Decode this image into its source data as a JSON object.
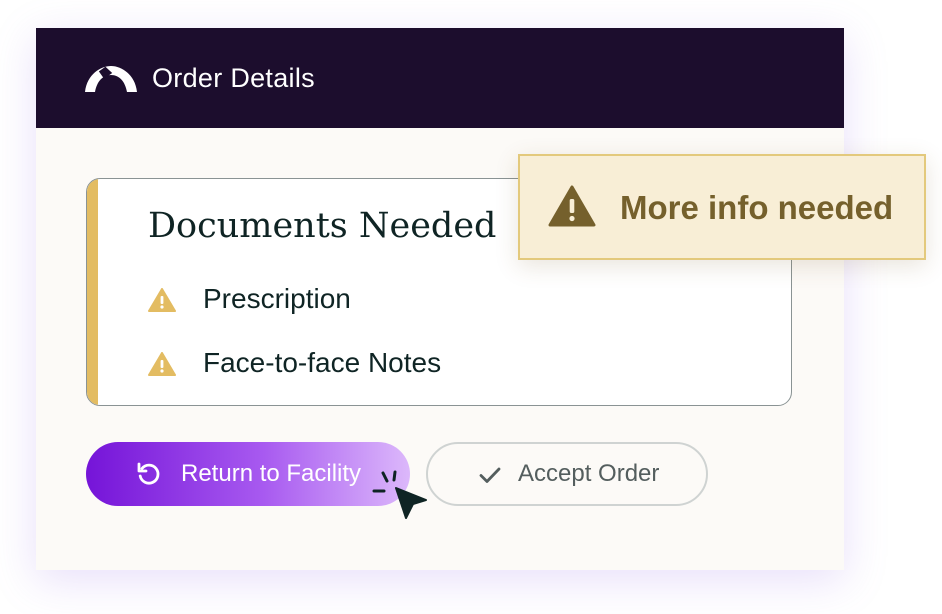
{
  "header": {
    "title": "Order Details",
    "logo": "arch-logo-icon",
    "background_color": "#1c0d2d"
  },
  "documents": {
    "title": "Documents Needed",
    "accent_color": "#e3bc62",
    "items": [
      {
        "label": "Prescription",
        "icon": "warning-icon"
      },
      {
        "label": "Face-to-face Notes",
        "icon": "warning-icon"
      }
    ]
  },
  "actions": {
    "return_label": "Return to Facility",
    "return_icon": "refresh-icon",
    "accept_label": "Accept Order",
    "accept_icon": "checkmark-icon",
    "primary_color": "#7514d8"
  },
  "alert": {
    "label": "More info needed",
    "icon": "warning-icon",
    "background_color": "#f8eed6",
    "text_color": "#75602c"
  }
}
